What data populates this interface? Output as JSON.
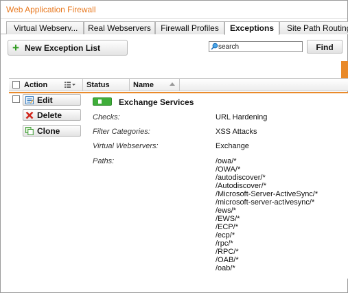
{
  "window": {
    "title": "Web Application Firewall"
  },
  "tabs": [
    {
      "label": "Virtual Webserv...",
      "active": false
    },
    {
      "label": "Real Webservers",
      "active": false
    },
    {
      "label": "Firewall Profiles",
      "active": false
    },
    {
      "label": "Exceptions",
      "active": true
    },
    {
      "label": "Site Path Routing",
      "active": false
    }
  ],
  "toolbar": {
    "new_button_label": "New Exception List",
    "search_value": "search",
    "find_button_label": "Find"
  },
  "table": {
    "headers": {
      "action": "Action",
      "status": "Status",
      "name": "Name"
    }
  },
  "row": {
    "actions": {
      "edit": "Edit",
      "delete": "Delete",
      "clone": "Clone"
    },
    "status_enabled": true,
    "name": "Exchange Services",
    "details": {
      "checks_label": "Checks:",
      "checks_value": "URL Hardening",
      "filter_label": "Filter Categories:",
      "filter_value": "XSS Attacks",
      "vws_label": "Virtual Webservers:",
      "vws_value": "Exchange",
      "paths_label": "Paths:"
    },
    "paths": [
      "/owa/*",
      "/OWA/*",
      "/autodiscover/*",
      "/Autodiscover/*",
      "/Microsoft-Server-ActiveSync/*",
      "/microsoft-server-activesync/*",
      "/ews/*",
      "/EWS/*",
      "/ECP/*",
      "/ecp/*",
      "/rpc/*",
      "/RPC/*",
      "/OAB/*",
      "/oab/*"
    ]
  },
  "colors": {
    "accent_orange": "#e98a2a",
    "title_orange": "#e8781e",
    "status_green": "#3fae3a",
    "plus_green": "#2e9a1e",
    "delete_red": "#d0261d"
  },
  "icons": {
    "new": "plus-icon",
    "search": "search-icon",
    "edit": "edit-icon",
    "delete": "delete-icon",
    "clone": "clone-icon",
    "column_menu": "column-menu-icon",
    "sort": "sort-arrow-icon"
  }
}
